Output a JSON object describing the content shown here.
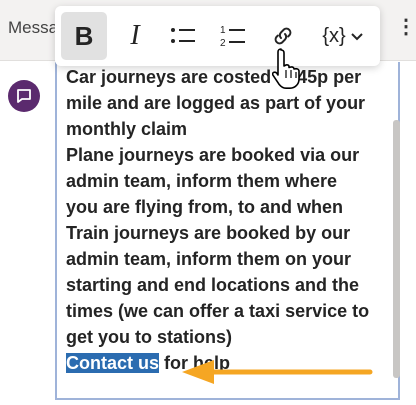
{
  "topbar": {
    "label": "Messa"
  },
  "toolbar": {
    "bold_label": "B",
    "italic_label": "I",
    "variables_label": "{x}"
  },
  "editor": {
    "lines": [
      "Car journeys are costed at 45p per",
      "mile and are logged as part of your",
      "monthly claim",
      "Plane journeys are booked via our",
      "admin team, inform them where",
      "you are flying from, to and when",
      "Train journeys are booked by our",
      "admin team, inform them on your",
      "starting and end locations and the",
      "times (we can offer a taxi service to",
      "get you to stations)"
    ],
    "selected_text": "Contact us",
    "after_selected": " for help"
  },
  "colors": {
    "selection": "#2b6cb0",
    "arrow": "#f5a623",
    "avatar": "#5b2a6e",
    "editor_border": "#9fb3d9"
  }
}
